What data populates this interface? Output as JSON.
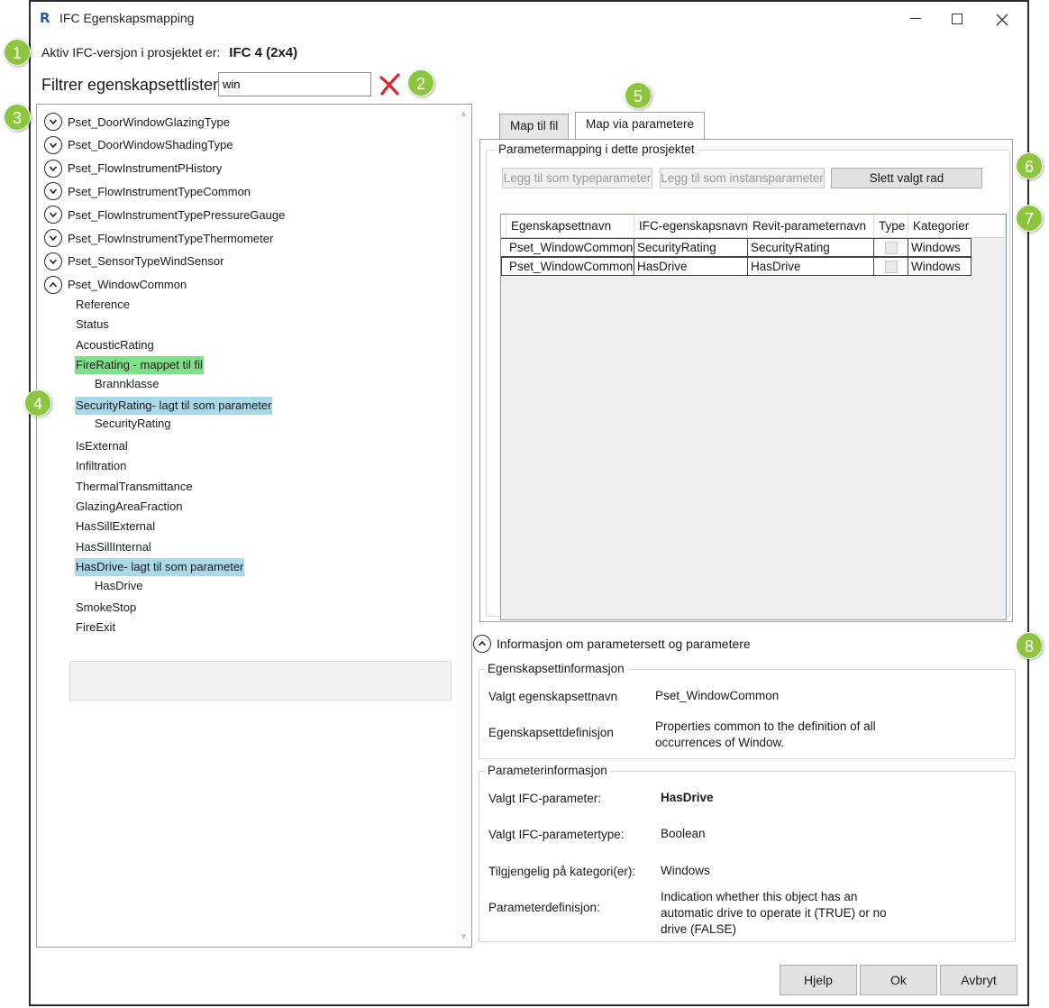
{
  "window": {
    "app_icon": "R",
    "title": "IFC Egenskapsmapping"
  },
  "version": {
    "label": "Aktiv IFC-versjon i prosjektet er:",
    "value": "IFC 4 (2x4)"
  },
  "filter": {
    "label": "Filtrer egenskapsettlisten",
    "value": "win"
  },
  "tree": {
    "sets": [
      {
        "label": "Pset_DoorWindowGlazingType",
        "expanded": false
      },
      {
        "label": "Pset_DoorWindowShadingType",
        "expanded": false
      },
      {
        "label": "Pset_FlowInstrumentPHistory",
        "expanded": false
      },
      {
        "label": "Pset_FlowInstrumentTypeCommon",
        "expanded": false
      },
      {
        "label": "Pset_FlowInstrumentTypePressureGauge",
        "expanded": false
      },
      {
        "label": "Pset_FlowInstrumentTypeThermometer",
        "expanded": false
      },
      {
        "label": "Pset_SensorTypeWindSensor",
        "expanded": false
      },
      {
        "label": "Pset_WindowCommon",
        "expanded": true
      }
    ],
    "properties": [
      {
        "label": "Reference"
      },
      {
        "label": "Status"
      },
      {
        "label": "AcousticRating"
      },
      {
        "label": "FireRating - mappet til fil",
        "highlight": "green",
        "child": "Brannklasse"
      },
      {
        "label": "SecurityRating- lagt til som parameter",
        "highlight": "blue",
        "child": "SecurityRating"
      },
      {
        "label": "IsExternal"
      },
      {
        "label": "Infiltration"
      },
      {
        "label": "ThermalTransmittance"
      },
      {
        "label": "GlazingAreaFraction"
      },
      {
        "label": "HasSillExternal"
      },
      {
        "label": "HasSillInternal"
      },
      {
        "label": "HasDrive- lagt til som parameter",
        "highlight": "blue",
        "child": "HasDrive",
        "selected": true
      },
      {
        "label": "SmokeStop"
      },
      {
        "label": "FireExit"
      }
    ]
  },
  "tabs": [
    {
      "label": "Map til fil",
      "active": false
    },
    {
      "label": "Map via parametere",
      "active": true
    }
  ],
  "mapping": {
    "group_title": "Parametermapping i dette prosjektet",
    "buttons": {
      "add_type": "Legg til som typeparameter",
      "add_instance": "Legg til som instansparameter",
      "delete_row": "Slett valgt rad"
    },
    "columns": [
      "Egenskapsettnavn",
      "IFC-egenskapsnavn",
      "Revit-parameternavn",
      "Type",
      "Kategorier"
    ],
    "rows": [
      {
        "pset": "Pset_WindowCommon",
        "ifc": "SecurityRating",
        "revit": "SecurityRating",
        "type": false,
        "categories": "Windows"
      },
      {
        "pset": "Pset_WindowCommon",
        "ifc": "HasDrive",
        "revit": "HasDrive",
        "type": false,
        "categories": "Windows"
      }
    ]
  },
  "info": {
    "header": "Informasjon om parametersett og parametere",
    "pset_group": {
      "title": "Egenskapsettinformasjon",
      "selected_label": "Valgt egenskapsettnavn",
      "selected_value": "Pset_WindowCommon",
      "definition_label": "Egenskapsettdefinisjon",
      "definition_value": "Properties common to the definition of all occurrences of Window."
    },
    "param_group": {
      "title": "Parameterinformasjon",
      "param_label": "Valgt IFC-parameter:",
      "param_value": "HasDrive",
      "type_label": "Valgt IFC-parametertype:",
      "type_value": "Boolean",
      "category_label": "Tilgjengelig på kategori(er):",
      "category_value": "Windows",
      "definition_label": "Parameterdefinisjon:",
      "definition_value": "Indication whether this object has an automatic drive to operate it (TRUE) or no drive (FALSE)"
    }
  },
  "footer": {
    "help": "Hjelp",
    "ok": "Ok",
    "cancel": "Avbryt"
  },
  "callouts": [
    "1",
    "2",
    "3",
    "4",
    "5",
    "6",
    "7",
    "8"
  ],
  "colors": {
    "callout": "#8cc63f",
    "highlight_green": "#7fe08a",
    "highlight_blue": "#a9d8e8",
    "clear_icon": "#d9262c"
  }
}
